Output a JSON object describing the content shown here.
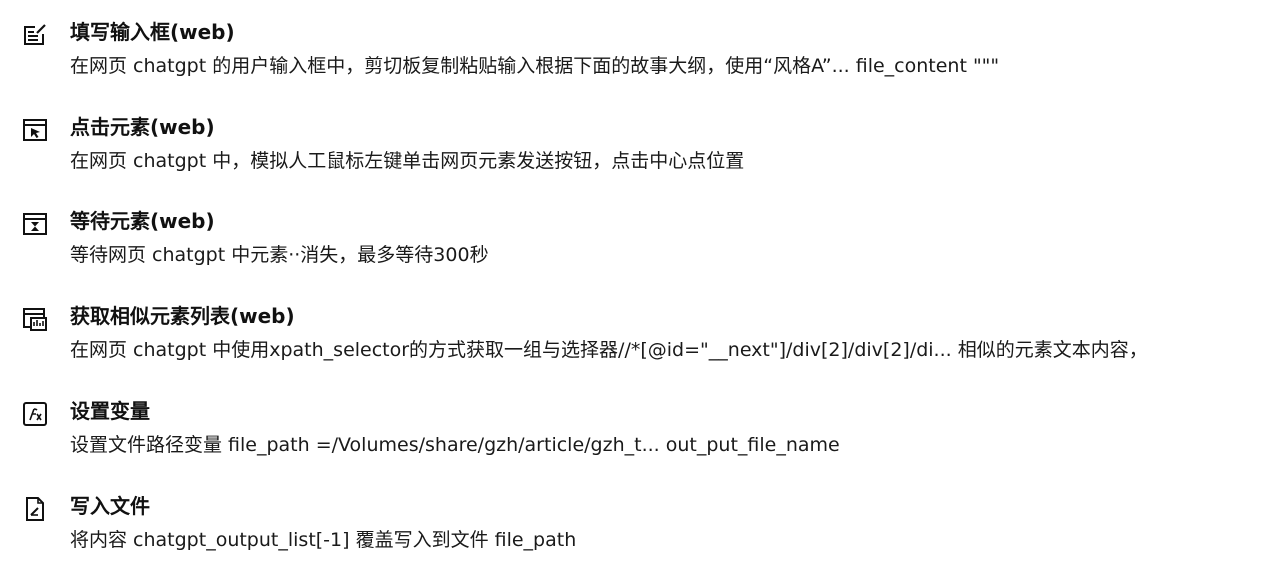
{
  "steps": [
    {
      "icon": "fill-input-icon",
      "title": "填写输入框(web)",
      "desc": "在网页  chatgpt  的用户输入框中，剪切板复制粘贴输入根据下面的故事大纲，使用“风格A”...   file_content   \"\"\""
    },
    {
      "icon": "click-element-icon",
      "title": "点击元素(web)",
      "desc": "在网页  chatgpt  中，模拟人工鼠标左键单击网页元素发送按钮，点击中心点位置"
    },
    {
      "icon": "wait-element-icon",
      "title": "等待元素(web)",
      "desc": "等待网页  chatgpt  中元素··消失，最多等待300秒"
    },
    {
      "icon": "similar-elements-icon",
      "title": "获取相似元素列表(web)",
      "desc": "在网页  chatgpt  中使用xpath_selector的方式获取一组与选择器//*[@id=\"__next\"]/div[2]/div[2]/di... 相似的元素文本内容，"
    },
    {
      "icon": "set-variable-icon",
      "title": "设置变量",
      "desc": "设置文件路径变量  file_path  =/Volumes/share/gzh/article/gzh_t...   out_put_file_name"
    },
    {
      "icon": "write-file-icon",
      "title": "写入文件",
      "desc": "将内容  chatgpt_output_list[-1]  覆盖写入到文件  file_path"
    }
  ]
}
